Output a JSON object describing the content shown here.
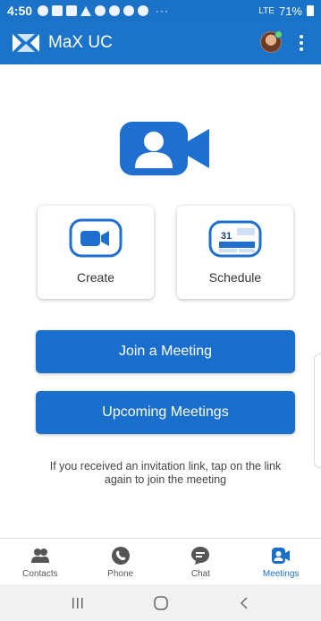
{
  "status_bar": {
    "time": "4:50",
    "more": "···",
    "signal_text": "LTE",
    "battery": "71%"
  },
  "app_bar": {
    "title": "MaX UC",
    "logo_icon": "max-uc-logo",
    "avatar": "user-avatar",
    "menu_icon": "kebab-menu-icon"
  },
  "main": {
    "hero_icon": "video-meeting-icon",
    "create_label": "Create",
    "schedule_label": "Schedule",
    "calendar_day": "31",
    "join_label": "Join a Meeting",
    "upcoming_label": "Upcoming Meetings",
    "info_text": "If you received an invitation link, tap on the link again to join the meeting"
  },
  "bottom_nav": {
    "items": [
      {
        "label": "Contacts",
        "icon": "contacts-icon",
        "active": false
      },
      {
        "label": "Phone",
        "icon": "phone-icon",
        "active": false
      },
      {
        "label": "Chat",
        "icon": "chat-icon",
        "active": false
      },
      {
        "label": "Meetings",
        "icon": "meetings-icon",
        "active": true
      }
    ]
  },
  "colors": {
    "primary": "#1b74c9",
    "button": "#1b6fcc",
    "icon_blue": "#1e6fd0",
    "nav_gray": "#555555"
  }
}
